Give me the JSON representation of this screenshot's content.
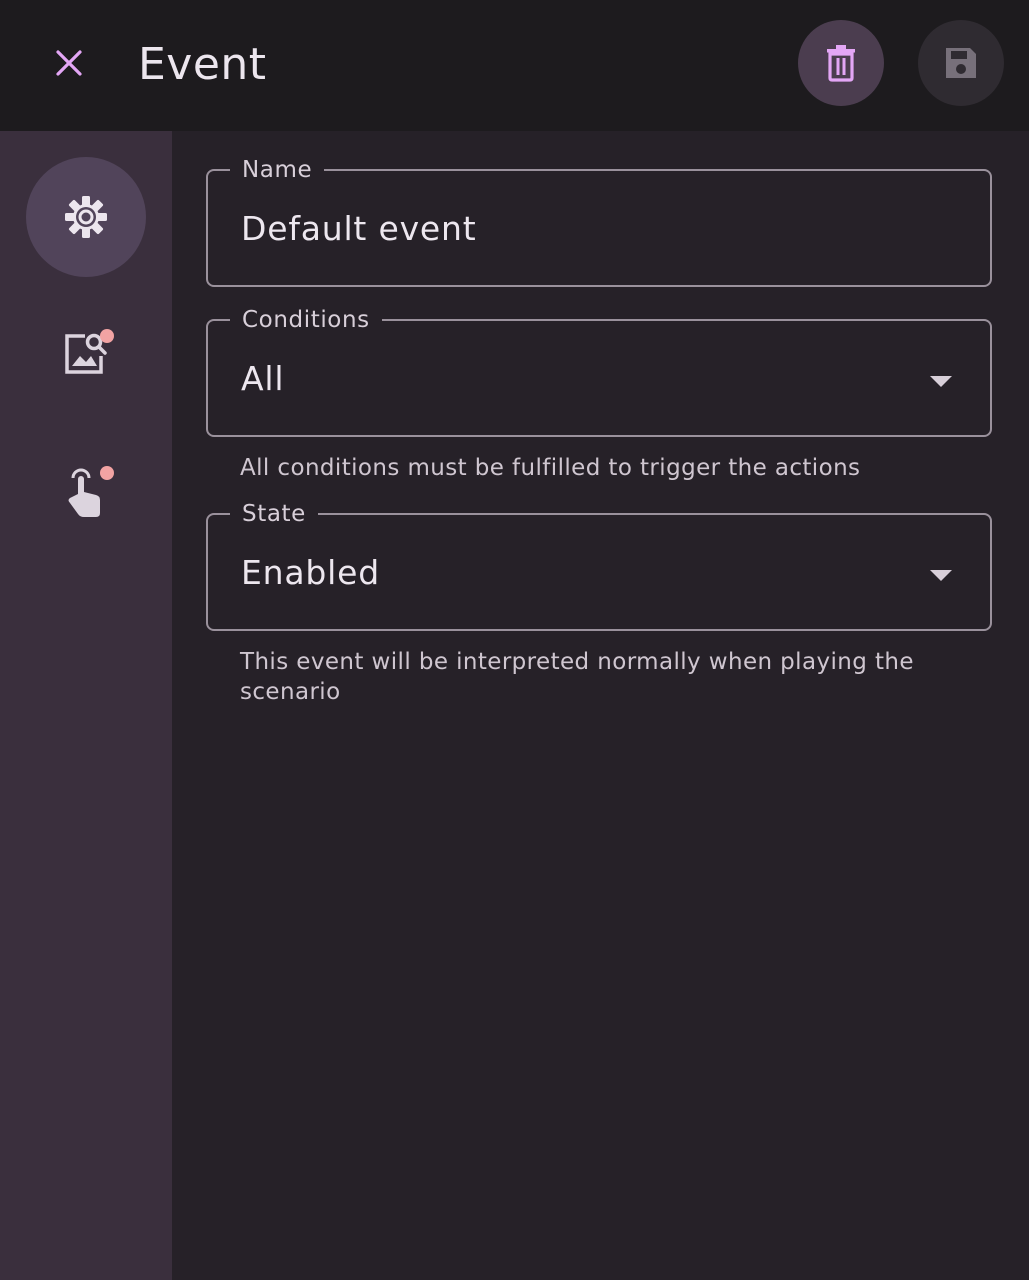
{
  "header": {
    "title": "Event",
    "close_icon": "close-icon",
    "delete_icon": "trash-icon",
    "save_icon": "save-icon"
  },
  "sidebar": {
    "items": [
      {
        "icon": "settings-icon",
        "active": true,
        "badge": false
      },
      {
        "icon": "image-search-icon",
        "active": false,
        "badge": true
      },
      {
        "icon": "touch-icon",
        "active": false,
        "badge": true
      }
    ]
  },
  "form": {
    "name": {
      "label": "Name",
      "value": "Default event"
    },
    "conditions": {
      "label": "Conditions",
      "value": "All",
      "helper": "All conditions must be fulfilled to trigger the actions"
    },
    "state": {
      "label": "State",
      "value": "Enabled",
      "helper": "This event will be interpreted normally when playing the scenario"
    }
  },
  "colors": {
    "accent": "#e3a6f5",
    "badge": "#f2a3a3",
    "background": "#262128",
    "sidebar": "#3a2f3d",
    "topbar": "#1d1b1e"
  }
}
